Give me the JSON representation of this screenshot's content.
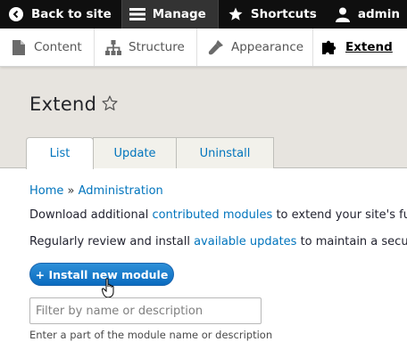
{
  "toolbar": {
    "back_label": "Back to site",
    "manage_label": "Manage",
    "shortcuts_label": "Shortcuts",
    "user_label": "admin"
  },
  "tray": {
    "content_label": "Content",
    "structure_label": "Structure",
    "appearance_label": "Appearance",
    "extend_label": "Extend"
  },
  "page": {
    "title": "Extend",
    "tabs": [
      {
        "label": "List"
      },
      {
        "label": "Update"
      },
      {
        "label": "Uninstall"
      }
    ],
    "breadcrumb": {
      "home": "Home",
      "separator": "»",
      "admin": "Administration"
    },
    "desc1": {
      "before": "Download additional ",
      "link": "contributed modules",
      "after": " to extend your site's fun"
    },
    "desc2": {
      "before": "Regularly review and install ",
      "link": "available updates",
      "after": " to maintain a secure"
    },
    "install_button": "+ Install new module",
    "filter": {
      "placeholder": "Filter by name or description",
      "value": "",
      "hint": "Enter a part of the module name or description"
    }
  },
  "colors": {
    "toolbar_bg": "#0f0f0f",
    "link": "#0074bd",
    "header_bg": "#e7e4df",
    "button_bg": "#0a6bbf"
  }
}
